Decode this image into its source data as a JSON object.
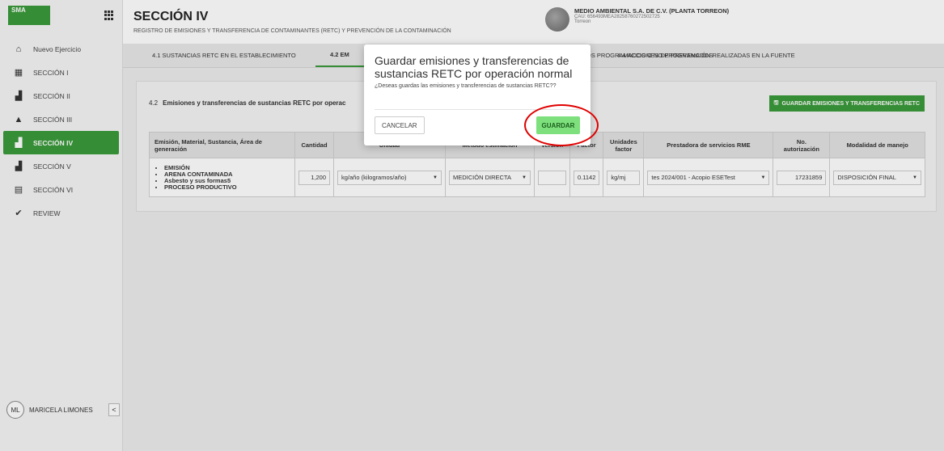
{
  "sidebar": {
    "logo": "SMA",
    "items": [
      {
        "label": "Nuevo Ejercicio",
        "icon": "home-icon"
      },
      {
        "label": "SECCIÓN I",
        "icon": "building-icon"
      },
      {
        "label": "SECCIÓN II",
        "icon": "factory-icon"
      },
      {
        "label": "SECCIÓN III",
        "icon": "warning-icon"
      },
      {
        "label": "SECCIÓN IV",
        "icon": "flask-icon"
      },
      {
        "label": "SECCIÓN V",
        "icon": "factory-icon"
      },
      {
        "label": "SECCIÓN VI",
        "icon": "document-icon"
      },
      {
        "label": "REVIEW",
        "icon": "check-circle-icon"
      }
    ],
    "user_initials": "ML",
    "user_name": "MARICELA LIMONES",
    "collapse": "<"
  },
  "header": {
    "title": "SECCIÓN IV",
    "subtitle": "REGISTRO DE EMISIONES Y TRANSFERENCIA DE CONTAMINANTES (RETC) Y PREVENCIÓN DE LA CONTAMINACIÓN",
    "company": "MEDIO AMBIENTAL S.A. DE C.V. (PLANTA TORREON)",
    "cau": "CAU: 656493MEA28258760272502725",
    "city": "Torreon"
  },
  "tabs": [
    "4.1 SUSTANCIAS RETC EN EL ESTABLECIMIENTO",
    "4.2 EM",
    "OS PROGRAMADOS O NO PROGRAMADOS",
    "4.4 ACCIONES DE PREVENCIÓN REALIZADAS EN LA FUENTE"
  ],
  "card": {
    "number": "4.2",
    "title": "Emisiones y transferencias de sustancias RETC por operac",
    "save_all": "GUARDAR EMISIONES Y TRANSFERENCIAS RETC",
    "columns": [
      "Emisión, Material, Sustancia, Área de generación",
      "Cantidad",
      "Unidad",
      "Método estimación",
      "Versión",
      "Factor",
      "Unidades factor",
      "Prestadora de servicios RME",
      "No. autorización",
      "Modalidad de manejo"
    ],
    "row": {
      "items": [
        "EMISIÓN",
        "ARENA CONTAMINADA",
        "Asbesto y sus formas5",
        "PROCESO PRODUCTIVO"
      ],
      "cantidad": "1,200",
      "unidad": "kg/año (kilogramos/año)",
      "metodo": "MEDICIÓN DIRECTA",
      "version": "",
      "factor": "0.1142",
      "unidades_factor": "kg/mj",
      "prestadora": "tes 2024/001 - Acopio ESETest",
      "autorizacion": "17231859",
      "modalidad": "DISPOSICIÓN FINAL"
    }
  },
  "modal": {
    "title": "Guardar emisiones y transferencias de sustancias RETC por operación normal",
    "body": "¿Deseas guardas las emisiones y transferencias de sustancias RETC??",
    "cancel": "CANCELAR",
    "save": "GUARDAR"
  }
}
